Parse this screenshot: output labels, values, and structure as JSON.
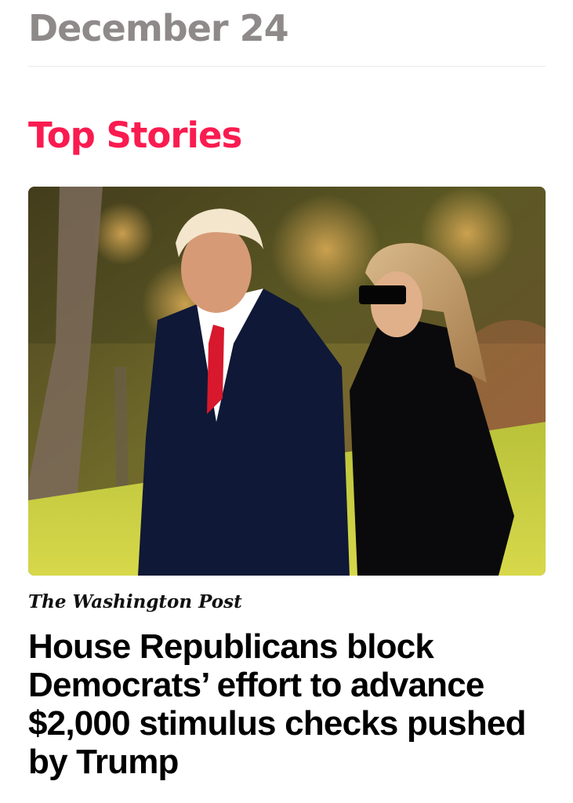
{
  "header": {
    "date": "December 24"
  },
  "section": {
    "title": "Top Stories",
    "accent_color": "#fa1b50"
  },
  "top_story": {
    "source": "The Washington Post",
    "headline": "House Republicans block Democrats’ effort to advance $2,000 stimulus checks pushed by Trump"
  }
}
